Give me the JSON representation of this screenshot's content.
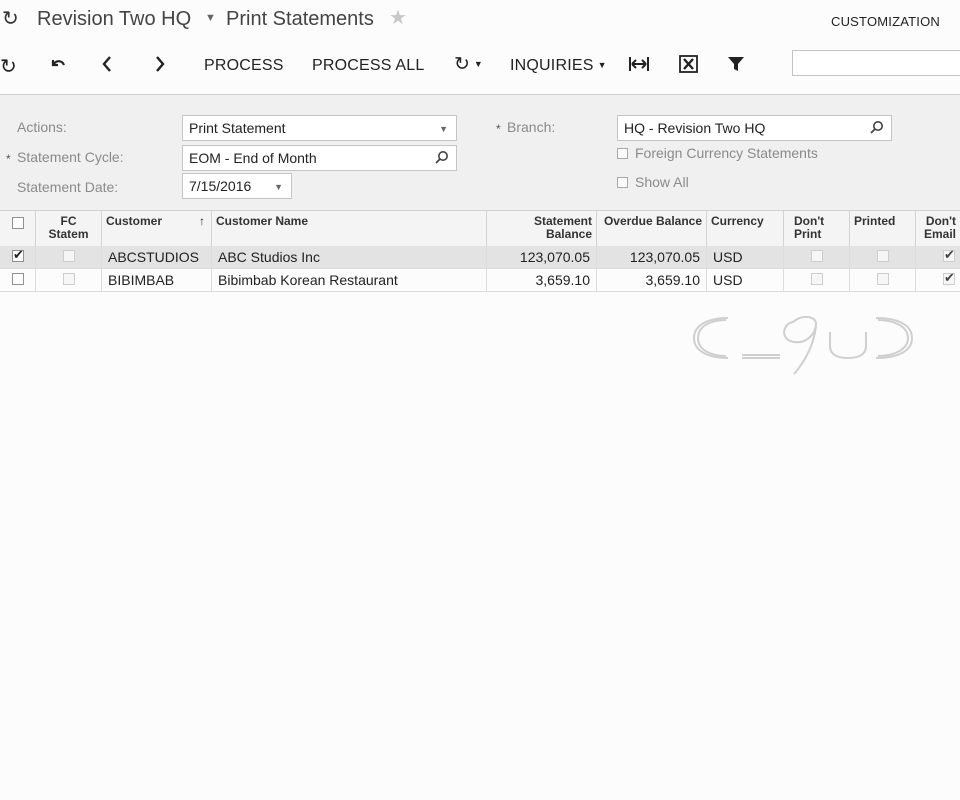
{
  "titlebar": {
    "company": "Revision Two HQ",
    "screen_title": "Print Statements",
    "customization": "CUSTOMIZATION"
  },
  "toolbar": {
    "process": "PROCESS",
    "process_all": "PROCESS ALL",
    "inquiries": "INQUIRIES"
  },
  "form": {
    "actions_label": "Actions:",
    "actions_value": "Print Statement",
    "cycle_label": "Statement Cycle:",
    "cycle_value": "EOM - End of Month",
    "date_label": "Statement Date:",
    "date_value": "7/15/2016",
    "branch_label": "Branch:",
    "branch_value": "HQ - Revision Two HQ",
    "fc_statements_label": "Foreign Currency Statements",
    "show_all_label": "Show All",
    "required_mark": "*"
  },
  "grid": {
    "headers": {
      "fc": "FC Statem",
      "customer": "Customer",
      "customer_name": "Customer Name",
      "statement_balance": "Statement Balance",
      "overdue_balance": "Overdue Balance",
      "currency": "Currency",
      "dont_print": "Don't Print",
      "printed": "Printed",
      "dont_email": "Don't Email",
      "sort_indicator": "↑"
    },
    "rows": [
      {
        "selected": true,
        "customer": "ABCSTUDIOS",
        "customer_name": "ABC Studios Inc",
        "statement_balance": "123,070.05",
        "overdue_balance": "123,070.05",
        "currency": "USD",
        "fc": false,
        "dont_print": false,
        "printed": false,
        "dont_email": true
      },
      {
        "selected": false,
        "customer": "BIBIMBAB",
        "customer_name": "Bibimbab Korean Restaurant",
        "statement_balance": "3,659.10",
        "overdue_balance": "3,659.10",
        "currency": "USD",
        "fc": false,
        "dont_print": false,
        "printed": false,
        "dont_email": true
      }
    ]
  },
  "icons": {
    "refresh": "refresh-icon",
    "undo": "undo-icon",
    "prev": "chevron-left-icon",
    "next": "chevron-right-icon",
    "fit": "fit-columns-icon",
    "export": "export-excel-icon",
    "filter": "filter-icon",
    "star": "star-icon"
  },
  "colors": {
    "form_bg": "#f0f0f0",
    "selected_row": "#e3e3e3",
    "label": "#8a8a8a"
  }
}
